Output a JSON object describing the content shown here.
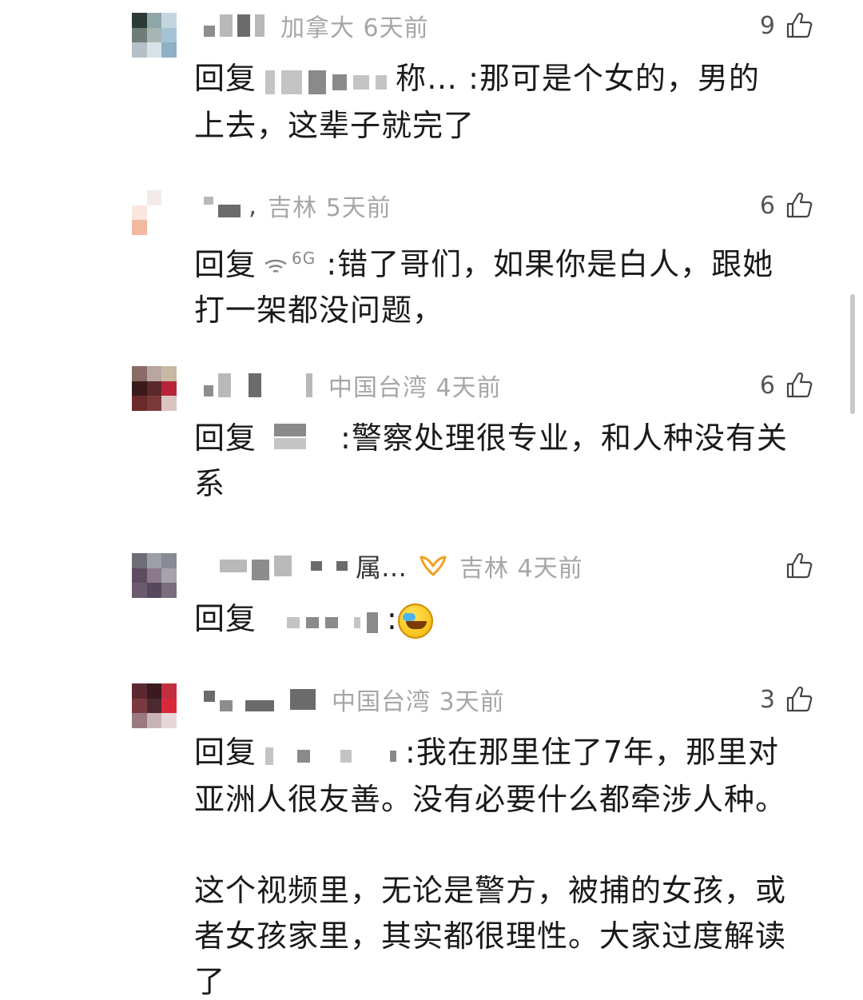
{
  "comments": [
    {
      "location_time": "加拿大 6天前",
      "likes": "9",
      "reply_label": "回复",
      "reply_target_suffix": "称…",
      "text_lines": [
        "那可是个女的，男的",
        "上去，这辈子就完了"
      ],
      "avatar_colors": [
        "#2c3a36",
        "#8fa6a8",
        "#c3d6de",
        "#6f7d76",
        "#a7b6b4",
        "#a4c4d6",
        "#b5c0c8",
        "#d9e2e6",
        "#8fb0c4"
      ]
    },
    {
      "location_time": "吉林 5天前",
      "likes": "6",
      "reply_label": "回复",
      "reply_target_suffix": "6G",
      "text_lines": [
        "错了哥们，如果你是白人，跟她",
        "打一架都没问题，"
      ],
      "avatar_colors": [
        "#ffffff",
        "#f3eaea",
        "#ffffff",
        "#fbe6dd",
        "#ffffff",
        "#ffffff",
        "#f0b9a0",
        "#ffffff",
        "#ffffff"
      ]
    },
    {
      "location_time": "中国台湾 4天前",
      "likes": "6",
      "reply_label": "回复",
      "text_lines": [
        "警察处理很专业，和人种没有关",
        "系"
      ],
      "avatar_colors": [
        "#8b6b68",
        "#b9a6a3",
        "#c7b9a4",
        "#3a1a1a",
        "#5a2a2a",
        "#b8233a",
        "#6b2a2a",
        "#7a3a3a",
        "#d9c4c0"
      ]
    },
    {
      "nick_suffix": "属…",
      "location_time": "吉林 4天前",
      "likes": "",
      "reply_label": "回复",
      "avatar_colors": [
        "#6d6d78",
        "#9aa0a6",
        "#8a8a94",
        "#5e4b5f",
        "#8a7a88",
        "#a6a3ad",
        "#6b5a6e",
        "#55485c",
        "#7a6e7e"
      ]
    },
    {
      "location_time": "中国台湾 3天前",
      "likes": "3",
      "reply_label": "回复",
      "text_lines": [
        "我在那里住了7年，那里对",
        "亚洲人很友善。没有必要什么都牵涉人种。"
      ],
      "text_lines_2": [
        "这个视频里，无论是警方，被捕的女孩，或",
        "者女孩家里，其实都很理性。大家过度解读",
        "了"
      ],
      "avatar_colors": [
        "#5a2a30",
        "#3a1a20",
        "#c23040",
        "#7a3a40",
        "#4a2a30",
        "#d8283a",
        "#9a7a80",
        "#c8b4b8",
        "#e6d8da"
      ]
    }
  ],
  "colors": {
    "meta_text": "#a6a6a6",
    "body_text": "#1a1a1a",
    "vip_orange": "#f0a020"
  },
  "icons": {
    "like": "thumbs-up-icon",
    "vip": "vip-badge-icon",
    "emoji": "facepalm-laugh-emoji"
  }
}
